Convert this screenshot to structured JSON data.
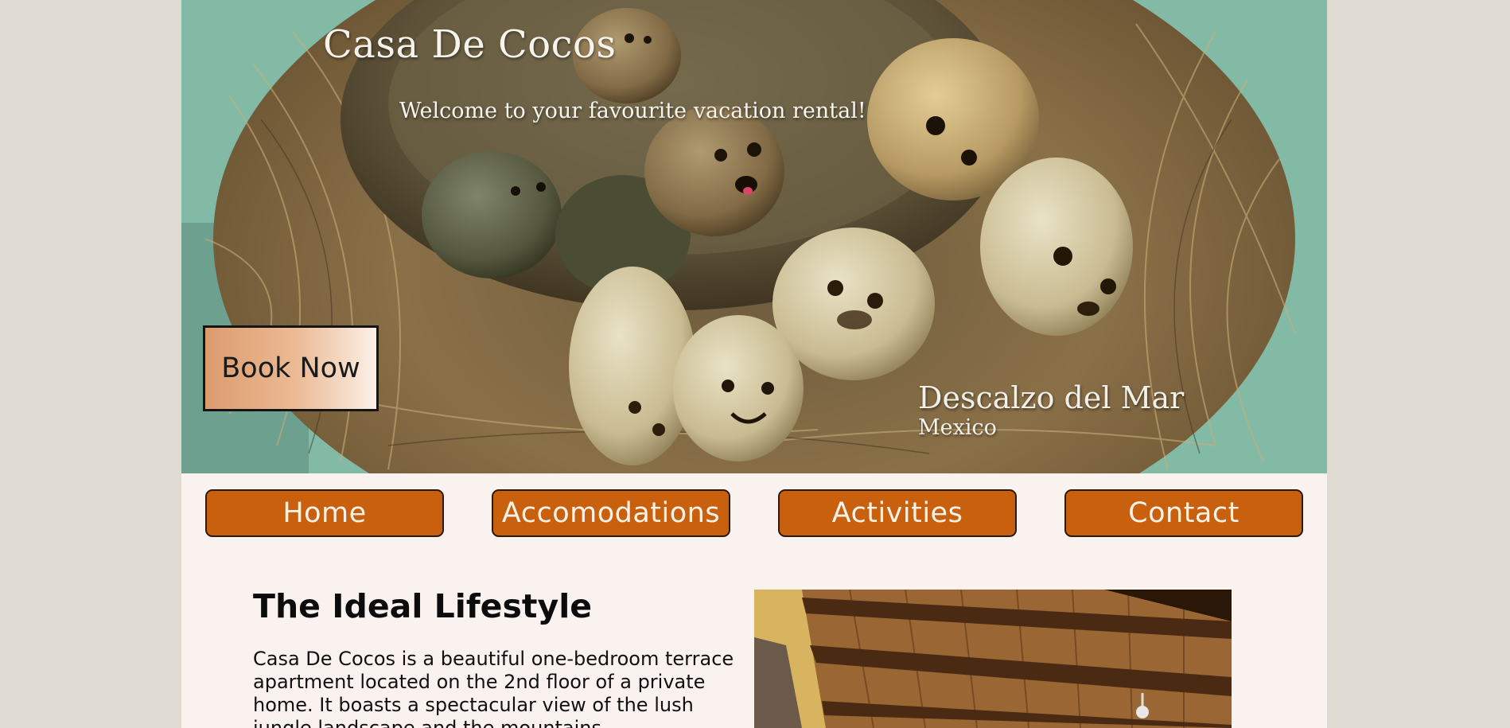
{
  "hero": {
    "title": "Casa De Cocos",
    "tagline": "Welcome to your favourite vacation rental!",
    "book_label": "Book Now",
    "location_place": "Descalzo del Mar",
    "location_country": "Mexico"
  },
  "nav": {
    "items": [
      {
        "label": "Home"
      },
      {
        "label": "Accomodations"
      },
      {
        "label": "Activities"
      },
      {
        "label": "Contact"
      }
    ]
  },
  "main": {
    "heading": "The Ideal Lifestyle",
    "paragraph": "Casa De Cocos is a beautiful one-bedroom terrace apartment located on the 2nd floor of a private home. It boasts a spectacular view of the lush jungle landscape and the mountains"
  },
  "colors": {
    "page_background": "#e0dbd2",
    "content_background": "#faf2ee",
    "nav_button": "#c8600e",
    "nav_text": "#fbf3ea",
    "book_button_gradient_start": "#dc9b6d",
    "book_button_gradient_end": "#fbf0e8"
  }
}
